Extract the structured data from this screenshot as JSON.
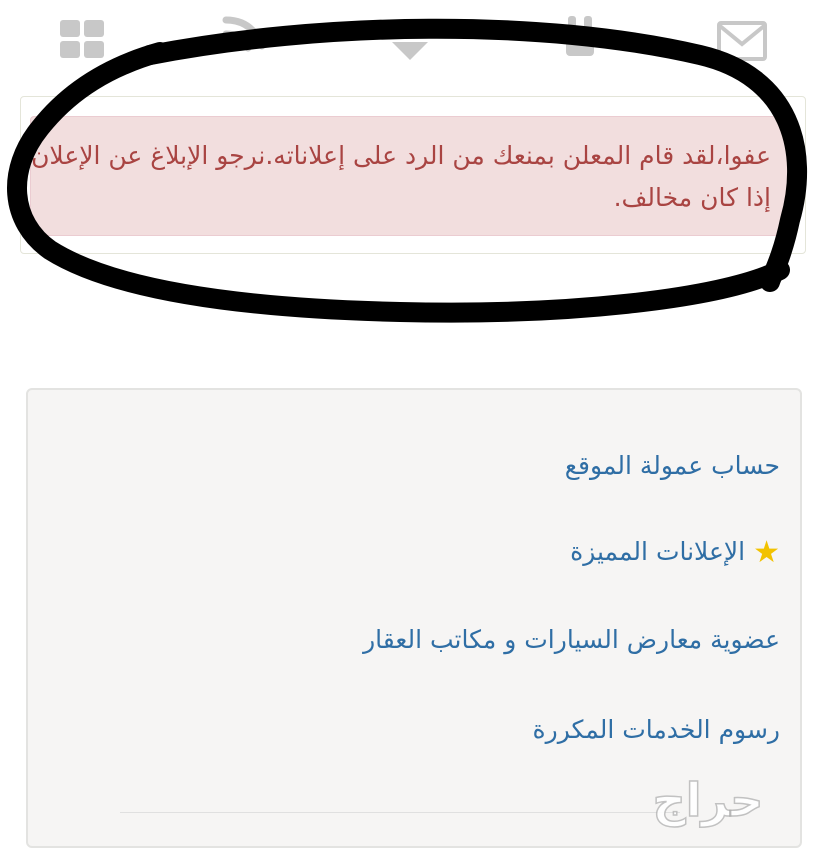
{
  "toolbar": {
    "icons": [
      "grid-icon",
      "rss-icon",
      "dropdown-caret-icon",
      "notification-bell-icon",
      "mail-icon"
    ]
  },
  "alert": {
    "message": "عفوا،لقد قام المعلن بمنعك من الرد على إعلاناته.نرجو الإبلاغ عن الإعلان إذا كان مخالف."
  },
  "menu": {
    "items": [
      {
        "label": "حساب عمولة الموقع"
      },
      {
        "label": "الإعلانات المميزة",
        "icon": "star-icon"
      },
      {
        "label": "عضوية معارض السيارات و مكاتب العقار"
      },
      {
        "label": "رسوم الخدمات المكررة"
      }
    ]
  },
  "watermark": {
    "text": "حراج"
  },
  "colors": {
    "alert_text": "#a94442",
    "alert_bg": "#f2dede",
    "link": "#2f6ea5",
    "star": "#f2c200",
    "icons": "#c8c8c8",
    "scribble": "#000000"
  }
}
